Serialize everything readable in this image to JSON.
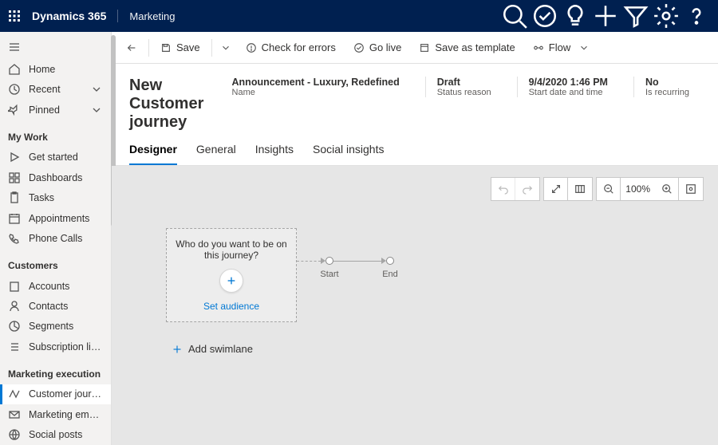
{
  "topbar": {
    "brand": "Dynamics 365",
    "area": "Marketing"
  },
  "topbar_actions": [
    "search",
    "task-check",
    "lightbulb",
    "plus",
    "filter",
    "settings",
    "help"
  ],
  "sidebar": {
    "burger": true,
    "primary": [
      {
        "icon": "home",
        "label": "Home"
      },
      {
        "icon": "clock",
        "label": "Recent",
        "expand": true
      },
      {
        "icon": "pin",
        "label": "Pinned",
        "expand": true
      }
    ],
    "groups": [
      {
        "title": "My Work",
        "items": [
          {
            "icon": "play",
            "label": "Get started"
          },
          {
            "icon": "dashboard",
            "label": "Dashboards"
          },
          {
            "icon": "clipboard",
            "label": "Tasks"
          },
          {
            "icon": "calendar",
            "label": "Appointments"
          },
          {
            "icon": "phone",
            "label": "Phone Calls"
          }
        ]
      },
      {
        "title": "Customers",
        "items": [
          {
            "icon": "building",
            "label": "Accounts"
          },
          {
            "icon": "person",
            "label": "Contacts"
          },
          {
            "icon": "segments",
            "label": "Segments"
          },
          {
            "icon": "list",
            "label": "Subscription lists"
          }
        ]
      },
      {
        "title": "Marketing execution",
        "items": [
          {
            "icon": "journey",
            "label": "Customer journeys",
            "active": true
          },
          {
            "icon": "mail",
            "label": "Marketing emails"
          },
          {
            "icon": "social",
            "label": "Social posts"
          }
        ]
      }
    ]
  },
  "commands": {
    "back": true,
    "items": [
      {
        "icon": "save",
        "label": "Save",
        "id": "save",
        "split": true
      },
      {
        "icon": "errors",
        "label": "Check for errors",
        "id": "check-errors"
      },
      {
        "icon": "golive",
        "label": "Go live",
        "id": "go-live"
      },
      {
        "icon": "template",
        "label": "Save as template",
        "id": "save-as-template"
      },
      {
        "icon": "flow",
        "label": "Flow",
        "id": "flow",
        "chevron": true
      }
    ]
  },
  "record": {
    "title": "New Customer journey",
    "fields": [
      {
        "value": "Announcement - Luxury, Redefined",
        "label": "Name"
      },
      {
        "value": "Draft",
        "label": "Status reason"
      },
      {
        "value": "9/4/2020 1:46 PM",
        "label": "Start date and time"
      },
      {
        "value": "No",
        "label": "Is recurring"
      }
    ]
  },
  "tabs": [
    "Designer",
    "General",
    "Insights",
    "Social insights"
  ],
  "active_tab": 0,
  "canvas": {
    "audience_question": "Who do you want to be on this journey?",
    "set_audience": "Set audience",
    "start_label": "Start",
    "end_label": "End",
    "add_swimlane": "Add swimlane",
    "zoom": "100%"
  }
}
